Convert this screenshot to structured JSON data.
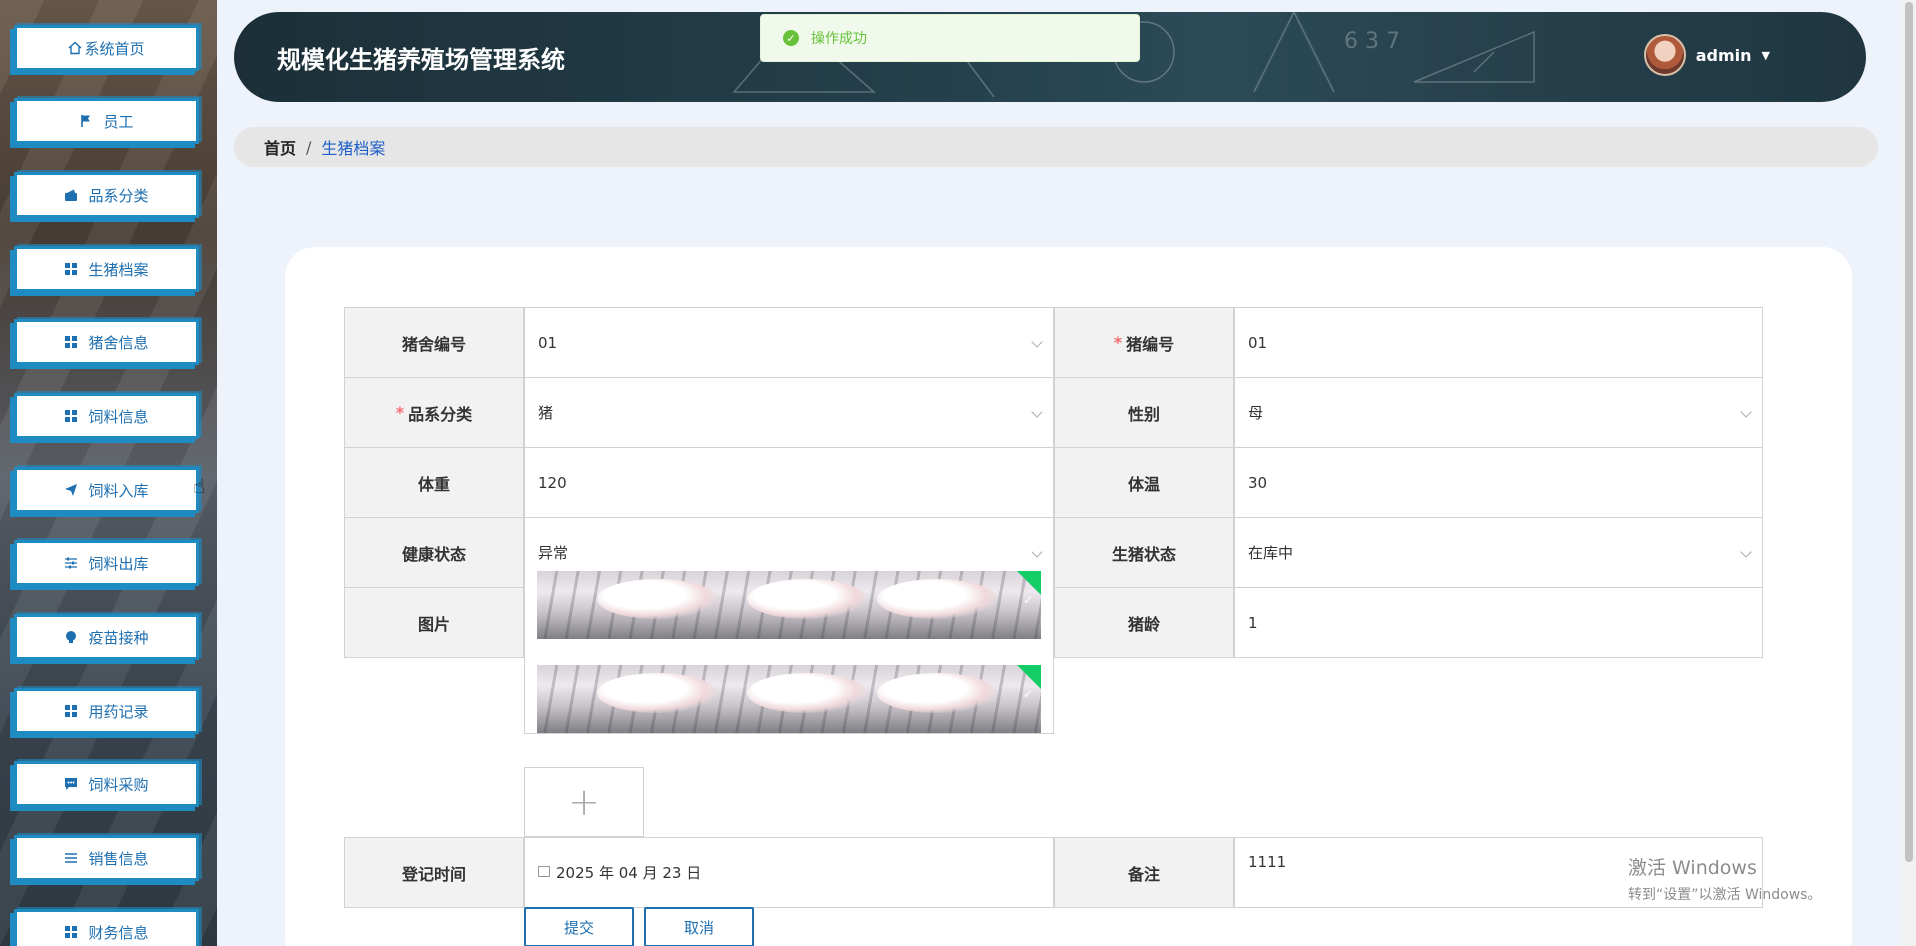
{
  "sidebar": {
    "items": [
      {
        "label": "系统首页",
        "icon": "home-icon"
      },
      {
        "label": "员工",
        "icon": "flag-icon"
      },
      {
        "label": "品系分类",
        "icon": "wallet-icon"
      },
      {
        "label": "生猪档案",
        "icon": "grid-icon"
      },
      {
        "label": "猪舍信息",
        "icon": "grid-icon"
      },
      {
        "label": "饲料信息",
        "icon": "grid-icon"
      },
      {
        "label": "饲料入库",
        "icon": "send-icon"
      },
      {
        "label": "饲料出库",
        "icon": "sliders-icon"
      },
      {
        "label": "疫苗接种",
        "icon": "bulb-icon"
      },
      {
        "label": "用药记录",
        "icon": "grid-icon"
      },
      {
        "label": "饲料采购",
        "icon": "chat-icon"
      },
      {
        "label": "销售信息",
        "icon": "list-icon"
      },
      {
        "label": "财务信息",
        "icon": "grid-icon"
      }
    ]
  },
  "header": {
    "title": "规模化生猪养殖场管理系统",
    "username": "admin"
  },
  "toast": {
    "message": "操作成功"
  },
  "breadcrumb": {
    "home": "首页",
    "separator": "/",
    "current": "生猪档案"
  },
  "form": {
    "pigsty_no": {
      "label": "猪舍编号",
      "value": "01"
    },
    "pig_no": {
      "label": "猪编号",
      "value": "01",
      "required": true
    },
    "breed": {
      "label": "品系分类",
      "value": "猪",
      "required": true
    },
    "gender": {
      "label": "性别",
      "value": "母"
    },
    "weight": {
      "label": "体重",
      "value": "120"
    },
    "temperature": {
      "label": "体温",
      "value": "30"
    },
    "health": {
      "label": "健康状态",
      "value": "异常"
    },
    "pig_status": {
      "label": "生猪状态",
      "value": "在库中"
    },
    "picture": {
      "label": "图片",
      "count": 2
    },
    "age": {
      "label": "猪龄",
      "value": "1"
    },
    "reg_time": {
      "label": "登记时间",
      "value": "2025 年 04 月 23 日"
    },
    "remark": {
      "label": "备注",
      "value": "1111"
    },
    "submit_label": "提交",
    "cancel_label": "取消"
  },
  "watermark": {
    "line1": "激活 Windows",
    "line2": "转到“设置”以激活 Windows。"
  },
  "colors": {
    "accent": "#1e6fb0",
    "success": "#67c23a",
    "required": "#f56c6c"
  }
}
